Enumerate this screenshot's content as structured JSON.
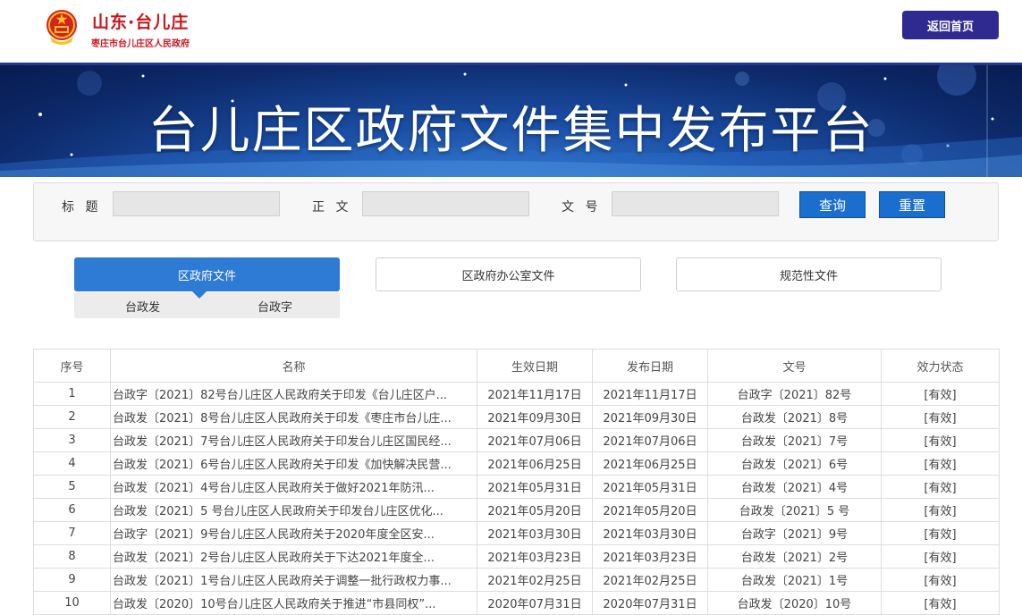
{
  "header": {
    "brand_title": "山东·台儿庄",
    "brand_subtitle": "枣庄市台儿庄区人民政府",
    "home_button": "返回首页"
  },
  "banner": {
    "title": "台儿庄区政府文件集中发布平台"
  },
  "search": {
    "title_label": "标 题",
    "body_label": "正 文",
    "doc_no_label": "文 号",
    "title_value": "",
    "body_value": "",
    "doc_no_value": "",
    "query_button": "查询",
    "reset_button": "重置"
  },
  "tabs": [
    {
      "label": "区政府文件",
      "active": true
    },
    {
      "label": "区政府办公室文件",
      "active": false
    },
    {
      "label": "规范性文件",
      "active": false
    }
  ],
  "subtabs": [
    "台政发",
    "台政字"
  ],
  "table": {
    "columns": [
      "序号",
      "名称",
      "生效日期",
      "发布日期",
      "文号",
      "效力状态"
    ],
    "rows": [
      [
        "1",
        "台政字〔2021〕82号台儿庄区人民政府关于印发《台儿庄区户...",
        "2021年11月17日",
        "2021年11月17日",
        "台政字〔2021〕82号",
        "[有效]"
      ],
      [
        "2",
        "台政发〔2021〕8号台儿庄区人民政府关于印发《枣庄市台儿庄...",
        "2021年09月30日",
        "2021年09月30日",
        "台政发〔2021〕8号",
        "[有效]"
      ],
      [
        "3",
        "台政发〔2021〕7号台儿庄区人民政府关于印发台儿庄区国民经...",
        "2021年07月06日",
        "2021年07月06日",
        "台政发〔2021〕7号",
        "[有效]"
      ],
      [
        "4",
        "台政发〔2021〕6号台儿庄区人民政府关于印发《加快解决民营...",
        "2021年06月25日",
        "2021年06月25日",
        "台政发〔2021〕6号",
        "[有效]"
      ],
      [
        "5",
        "台政发〔2021〕4号台儿庄区人民政府关于做好2021年防汛...",
        "2021年05月31日",
        "2021年05月31日",
        "台政发〔2021〕4号",
        "[有效]"
      ],
      [
        "6",
        "台政发〔2021〕5 号台儿庄区人民政府关于印发台儿庄区优化...",
        "2021年05月20日",
        "2021年05月20日",
        "台政发〔2021〕5 号",
        "[有效]"
      ],
      [
        "7",
        "台政字〔2021〕9号台儿庄区人民政府关于2020年度全区安...",
        "2021年03月30日",
        "2021年03月30日",
        "台政字〔2021〕9号",
        "[有效]"
      ],
      [
        "8",
        "台政发〔2021〕2号台儿庄区人民政府关于下达2021年度全...",
        "2021年03月23日",
        "2021年03月23日",
        "台政发〔2021〕2号",
        "[有效]"
      ],
      [
        "9",
        "台政发〔2021〕1号台儿庄区人民政府关于调整一批行政权力事...",
        "2021年02月25日",
        "2021年02月25日",
        "台政发〔2021〕1号",
        "[有效]"
      ],
      [
        "10",
        "台政发〔2020〕10号台儿庄区人民政府关于推进“市县同权”...",
        "2020年07月31日",
        "2020年07月31日",
        "台政发〔2020〕10号",
        "[有效]"
      ]
    ]
  }
}
